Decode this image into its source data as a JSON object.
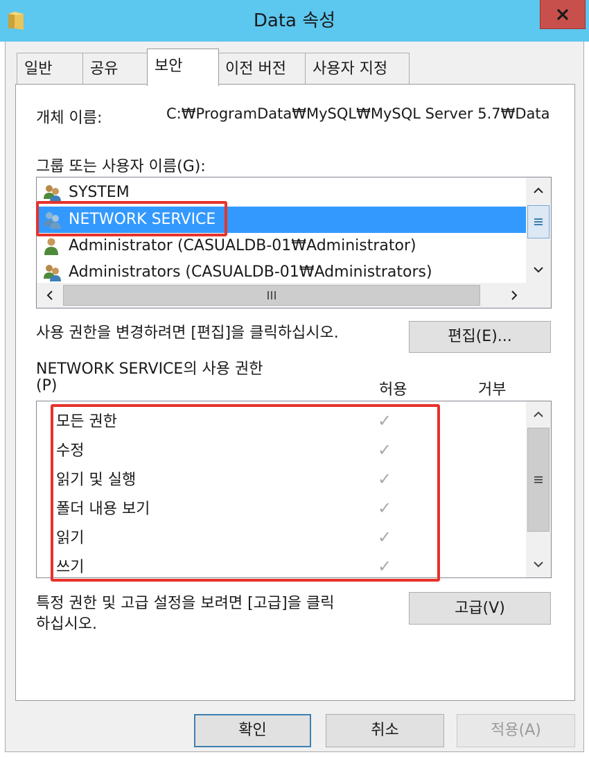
{
  "window": {
    "title": "Data 속성",
    "close_icon": "close-icon",
    "folder_icon": "folder-icon"
  },
  "tabs": [
    {
      "label": "일반",
      "active": false
    },
    {
      "label": "공유",
      "active": false
    },
    {
      "label": "보안",
      "active": true
    },
    {
      "label": "이전 버전",
      "active": false
    },
    {
      "label": "사용자 지정",
      "active": false
    }
  ],
  "security": {
    "object_name_label": "개체 이름:",
    "object_name_value": "C:₩ProgramData₩MySQL₩MySQL Server 5.7₩Data",
    "group_label": "그룹 또는 사용자 이름(G):",
    "users": [
      {
        "name": "SYSTEM",
        "icon": "user-group-icon",
        "selected": false
      },
      {
        "name": "NETWORK SERVICE",
        "icon": "user-group-icon",
        "selected": true
      },
      {
        "name": "Administrator (CASUALDB-01₩Administrator)",
        "icon": "user-icon",
        "selected": false
      },
      {
        "name": "Administrators (CASUALDB-01₩Administrators)",
        "icon": "user-group-icon",
        "selected": false
      }
    ],
    "edit_hint": "사용 권한을 변경하려면 [편집]을 클릭하십시오.",
    "edit_button": "편집(E)...",
    "perm_title_line1": "NETWORK SERVICE의 사용 권한",
    "perm_title_line2": "(P)",
    "allow_header": "허용",
    "deny_header": "거부",
    "permissions": [
      {
        "name": "모든 권한",
        "allow": true,
        "deny": false
      },
      {
        "name": "수정",
        "allow": true,
        "deny": false
      },
      {
        "name": "읽기 및 실행",
        "allow": true,
        "deny": false
      },
      {
        "name": "폴더 내용 보기",
        "allow": true,
        "deny": false
      },
      {
        "name": "읽기",
        "allow": true,
        "deny": false
      },
      {
        "name": "쓰기",
        "allow": true,
        "deny": false
      }
    ],
    "check_glyph": "✓",
    "advanced_hint_line1": "특정 권한 및 고급 설정을 보려면 [고급]을 클릭",
    "advanced_hint_line2": "하십시오.",
    "advanced_button": "고급(V)"
  },
  "footer": {
    "ok": "확인",
    "cancel": "취소",
    "apply": "적용(A)"
  },
  "colors": {
    "titlebar": "#5cc7ef",
    "close": "#c7504c",
    "selection": "#3399ff",
    "highlight": "#e6322b"
  }
}
